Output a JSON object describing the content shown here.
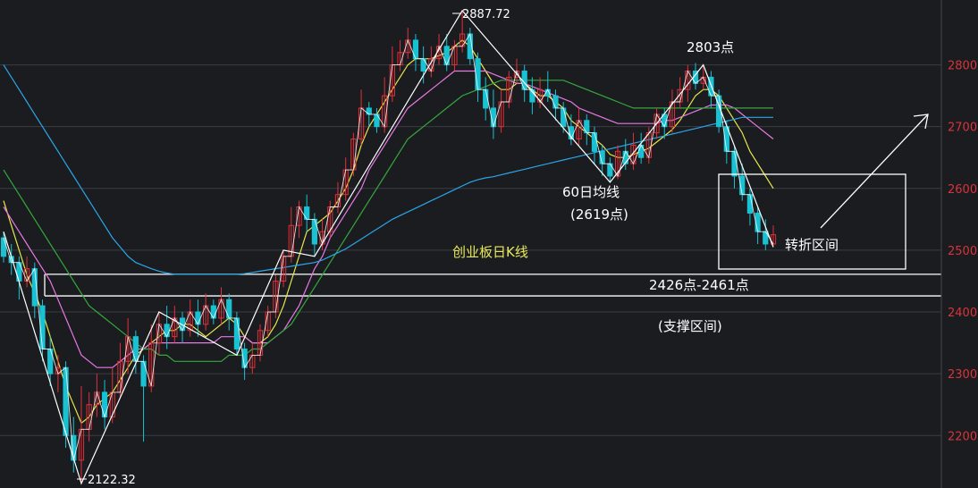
{
  "chart_data": {
    "type": "candlestick",
    "title": "创业板日K线",
    "ylim": [
      2115,
      2905
    ],
    "yticks": [
      2200,
      2300,
      2400,
      2500,
      2600,
      2700,
      2800
    ],
    "grid": true,
    "colors": {
      "background": "#1b1c20",
      "grid": "#3a3c44",
      "up": "#e0313a",
      "down": "#19c2d3",
      "axis_text": "#d8343b",
      "title": "#e8e85a",
      "note": "#ffffff",
      "line_white": "#ffffff",
      "line_yellow": "#e6e84a",
      "line_magenta": "#e878e4",
      "line_green": "#34a83c",
      "line_blue": "#2ba6e8"
    },
    "candles": [
      [
        2520,
        2490,
        2530,
        2480
      ],
      [
        2490,
        2480,
        2510,
        2460
      ],
      [
        2480,
        2450,
        2490,
        2420
      ],
      [
        2450,
        2470,
        2490,
        2440
      ],
      [
        2470,
        2410,
        2480,
        2390
      ],
      [
        2410,
        2340,
        2420,
        2320
      ],
      [
        2340,
        2300,
        2360,
        2280
      ],
      [
        2300,
        2310,
        2330,
        2270
      ],
      [
        2310,
        2200,
        2320,
        2180
      ],
      [
        2200,
        2160,
        2230,
        2140
      ],
      [
        2160,
        2210,
        2280,
        2122.32
      ],
      [
        2210,
        2250,
        2270,
        2190
      ],
      [
        2250,
        2270,
        2300,
        2230
      ],
      [
        2270,
        2230,
        2290,
        2210
      ],
      [
        2230,
        2270,
        2310,
        2220
      ],
      [
        2270,
        2320,
        2350,
        2260
      ],
      [
        2320,
        2360,
        2390,
        2300
      ],
      [
        2360,
        2320,
        2370,
        2300
      ],
      [
        2320,
        2280,
        2330,
        2190
      ],
      [
        2280,
        2350,
        2380,
        2270
      ],
      [
        2350,
        2380,
        2400,
        2330
      ],
      [
        2380,
        2360,
        2410,
        2340
      ],
      [
        2360,
        2390,
        2410,
        2350
      ],
      [
        2390,
        2370,
        2400,
        2350
      ],
      [
        2370,
        2400,
        2420,
        2360
      ],
      [
        2400,
        2380,
        2420,
        2360
      ],
      [
        2380,
        2410,
        2430,
        2370
      ],
      [
        2410,
        2390,
        2420,
        2380
      ],
      [
        2390,
        2420,
        2440,
        2380
      ],
      [
        2420,
        2390,
        2430,
        2370
      ],
      [
        2390,
        2340,
        2400,
        2330
      ],
      [
        2340,
        2310,
        2350,
        2290
      ],
      [
        2310,
        2330,
        2350,
        2300
      ],
      [
        2330,
        2370,
        2380,
        2320
      ],
      [
        2370,
        2400,
        2410,
        2360
      ],
      [
        2400,
        2450,
        2460,
        2390
      ],
      [
        2450,
        2490,
        2500,
        2440
      ],
      [
        2490,
        2540,
        2570,
        2480
      ],
      [
        2540,
        2570,
        2580,
        2520
      ],
      [
        2570,
        2550,
        2590,
        2530
      ],
      [
        2550,
        2510,
        2560,
        2490
      ],
      [
        2510,
        2530,
        2550,
        2500
      ],
      [
        2530,
        2570,
        2580,
        2520
      ],
      [
        2570,
        2590,
        2610,
        2560
      ],
      [
        2590,
        2630,
        2650,
        2580
      ],
      [
        2630,
        2680,
        2690,
        2620
      ],
      [
        2680,
        2730,
        2760,
        2670
      ],
      [
        2730,
        2720,
        2740,
        2700
      ],
      [
        2720,
        2700,
        2730,
        2690
      ],
      [
        2700,
        2750,
        2780,
        2690
      ],
      [
        2750,
        2800,
        2830,
        2740
      ],
      [
        2800,
        2820,
        2840,
        2790
      ],
      [
        2820,
        2840,
        2860,
        2810
      ],
      [
        2840,
        2810,
        2850,
        2790
      ],
      [
        2810,
        2790,
        2830,
        2770
      ],
      [
        2790,
        2810,
        2830,
        2780
      ],
      [
        2810,
        2830,
        2850,
        2800
      ],
      [
        2830,
        2800,
        2850,
        2790
      ],
      [
        2800,
        2830,
        2840,
        2790
      ],
      [
        2830,
        2850,
        2887.72,
        2820
      ],
      [
        2850,
        2810,
        2860,
        2800
      ],
      [
        2810,
        2760,
        2820,
        2740
      ],
      [
        2760,
        2730,
        2780,
        2710
      ],
      [
        2730,
        2700,
        2760,
        2680
      ],
      [
        2700,
        2740,
        2760,
        2690
      ],
      [
        2740,
        2780,
        2790,
        2730
      ],
      [
        2780,
        2790,
        2810,
        2770
      ],
      [
        2790,
        2760,
        2800,
        2740
      ],
      [
        2760,
        2740,
        2780,
        2720
      ],
      [
        2740,
        2760,
        2780,
        2730
      ],
      [
        2760,
        2750,
        2790,
        2740
      ],
      [
        2750,
        2730,
        2760,
        2710
      ],
      [
        2730,
        2700,
        2740,
        2690
      ],
      [
        2700,
        2680,
        2720,
        2670
      ],
      [
        2680,
        2710,
        2730,
        2670
      ],
      [
        2710,
        2690,
        2720,
        2670
      ],
      [
        2690,
        2660,
        2700,
        2640
      ],
      [
        2660,
        2640,
        2670,
        2620
      ],
      [
        2640,
        2620,
        2650,
        2610
      ],
      [
        2620,
        2660,
        2670,
        2615
      ],
      [
        2660,
        2640,
        2680,
        2630
      ],
      [
        2640,
        2670,
        2690,
        2630
      ],
      [
        2670,
        2650,
        2690,
        2640
      ],
      [
        2650,
        2690,
        2700,
        2640
      ],
      [
        2690,
        2720,
        2730,
        2680
      ],
      [
        2720,
        2700,
        2730,
        2680
      ],
      [
        2700,
        2740,
        2760,
        2690
      ],
      [
        2740,
        2760,
        2780,
        2730
      ],
      [
        2760,
        2790,
        2800,
        2740
      ],
      [
        2790,
        2770,
        2803,
        2760
      ],
      [
        2770,
        2780,
        2800,
        2760
      ],
      [
        2780,
        2750,
        2790,
        2730
      ],
      [
        2750,
        2700,
        2760,
        2690
      ],
      [
        2700,
        2660,
        2710,
        2640
      ],
      [
        2660,
        2620,
        2670,
        2600
      ],
      [
        2620,
        2590,
        2640,
        2580
      ],
      [
        2590,
        2560,
        2600,
        2540
      ],
      [
        2560,
        2530,
        2570,
        2510
      ],
      [
        2530,
        2510,
        2550,
        2500
      ],
      [
        2510,
        2525,
        2540,
        2505
      ]
    ],
    "series": [
      {
        "values": [
          2580,
          2540,
          2500,
          2460,
          2430,
          2400,
          2360,
          2320,
          2280,
          2250,
          2220,
          2230,
          2250,
          2260,
          2270,
          2290,
          2310,
          2330,
          2340,
          2350,
          2360,
          2370,
          2370,
          2380,
          2380,
          2370,
          2360,
          2370,
          2380,
          2390,
          2380,
          2360,
          2350,
          2350,
          2360,
          2380,
          2410,
          2450,
          2490,
          2530,
          2540,
          2550,
          2560,
          2580,
          2600,
          2630,
          2670,
          2700,
          2720,
          2740,
          2760,
          2780,
          2800,
          2810,
          2810,
          2810,
          2815,
          2820,
          2830,
          2840,
          2830,
          2810,
          2790,
          2770,
          2760,
          2760,
          2770,
          2770,
          2760,
          2750,
          2750,
          2740,
          2730,
          2710,
          2700,
          2690,
          2680,
          2670,
          2655,
          2650,
          2650,
          2655,
          2660,
          2665,
          2675,
          2685,
          2695,
          2710,
          2730,
          2750,
          2760,
          2760,
          2750,
          2730,
          2710,
          2690,
          2660,
          2640,
          2620,
          2600
        ]
      },
      {
        "values": [
          2570,
          2550,
          2530,
          2510,
          2490,
          2470,
          2450,
          2420,
          2390,
          2360,
          2330,
          2320,
          2310,
          2310,
          2310,
          2320,
          2330,
          2340,
          2340,
          2350,
          2350,
          2350,
          2350,
          2350,
          2350,
          2350,
          2350,
          2350,
          2360,
          2360,
          2360,
          2360,
          2350,
          2350,
          2350,
          2360,
          2370,
          2390,
          2410,
          2440,
          2470,
          2490,
          2520,
          2540,
          2560,
          2580,
          2600,
          2630,
          2650,
          2670,
          2690,
          2710,
          2730,
          2740,
          2750,
          2760,
          2770,
          2780,
          2790,
          2790,
          2790,
          2790,
          2790,
          2785,
          2780,
          2775,
          2770,
          2770,
          2765,
          2760,
          2755,
          2750,
          2745,
          2740,
          2730,
          2725,
          2720,
          2715,
          2710,
          2705,
          2705,
          2705,
          2705,
          2705,
          2705,
          2710,
          2710,
          2715,
          2720,
          2725,
          2730,
          2735,
          2735,
          2735,
          2730,
          2720,
          2710,
          2700,
          2690,
          2680
        ]
      },
      {
        "values": [
          2630,
          2610,
          2590,
          2570,
          2550,
          2530,
          2510,
          2490,
          2470,
          2450,
          2430,
          2410,
          2400,
          2390,
          2380,
          2370,
          2360,
          2350,
          2340,
          2340,
          2330,
          2330,
          2320,
          2320,
          2320,
          2320,
          2320,
          2320,
          2320,
          2330,
          2330,
          2330,
          2340,
          2340,
          2350,
          2360,
          2370,
          2380,
          2400,
          2420,
          2440,
          2460,
          2480,
          2500,
          2520,
          2540,
          2560,
          2580,
          2600,
          2620,
          2640,
          2660,
          2680,
          2690,
          2700,
          2710,
          2720,
          2730,
          2740,
          2750,
          2755,
          2760,
          2765,
          2770,
          2775,
          2775,
          2775,
          2775,
          2775,
          2775,
          2775,
          2775,
          2775,
          2770,
          2765,
          2760,
          2755,
          2750,
          2745,
          2740,
          2735,
          2730,
          2730,
          2730,
          2730,
          2730,
          2730,
          2730,
          2730,
          2730,
          2730,
          2730,
          2730,
          2730,
          2730,
          2730,
          2730,
          2730,
          2730,
          2730
        ]
      },
      {
        "values": [
          2800,
          2780,
          2760,
          2740,
          2720,
          2700,
          2680,
          2660,
          2640,
          2620,
          2600,
          2580,
          2560,
          2540,
          2520,
          2505,
          2490,
          2480,
          2475,
          2470,
          2466,
          2463,
          2461,
          2461,
          2461,
          2461,
          2461,
          2461,
          2461,
          2461,
          2461,
          2462,
          2464,
          2466,
          2468,
          2470,
          2472,
          2474,
          2476,
          2478,
          2480,
          2484,
          2490,
          2496,
          2502,
          2510,
          2518,
          2526,
          2534,
          2542,
          2550,
          2556,
          2562,
          2568,
          2574,
          2580,
          2586,
          2592,
          2598,
          2604,
          2610,
          2614,
          2617,
          2619,
          2622,
          2625,
          2628,
          2631,
          2634,
          2637,
          2640,
          2643,
          2646,
          2649,
          2652,
          2655,
          2658,
          2661,
          2664,
          2667,
          2670,
          2673,
          2676,
          2679,
          2682,
          2685,
          2688,
          2691,
          2694,
          2697,
          2700,
          2703,
          2706,
          2709,
          2712,
          2715,
          2715,
          2715,
          2715,
          2715
        ]
      }
    ],
    "peak_label": "2887.72",
    "low_label": "2122.32",
    "annotations": {
      "high_2803": "2803点",
      "ma60_name": "60日均线",
      "ma60_value": "(2619点)",
      "turn_zone": "转折区间",
      "support_range": "2426点-2461点",
      "support_name": "(支撑区间)"
    },
    "support_levels": [
      2426,
      2461
    ]
  }
}
